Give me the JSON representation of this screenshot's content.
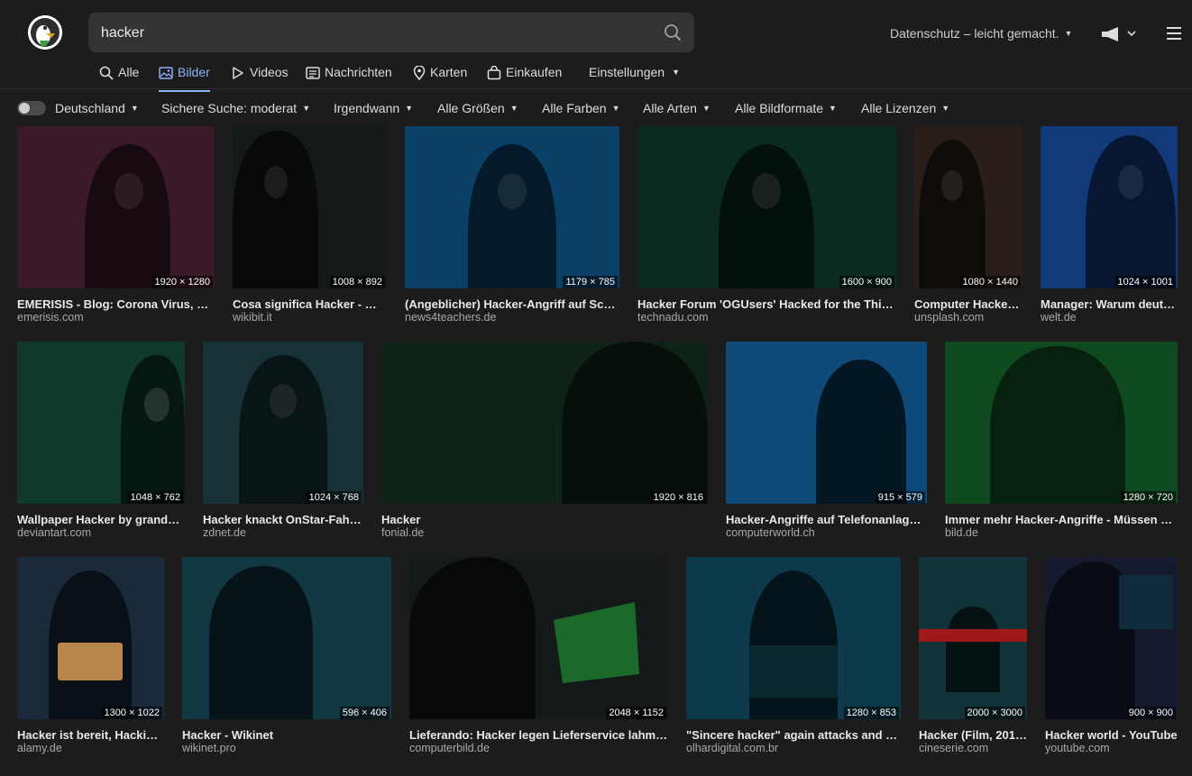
{
  "search": {
    "query": "hacker"
  },
  "header": {
    "privacy_label": "Datenschutz – leicht gemacht."
  },
  "tabs": [
    {
      "label": "Alle",
      "icon": "search-icon"
    },
    {
      "label": "Bilder",
      "icon": "image-icon",
      "active": true
    },
    {
      "label": "Videos",
      "icon": "play-icon"
    },
    {
      "label": "Nachrichten",
      "icon": "newspaper-icon"
    },
    {
      "label": "Karten",
      "icon": "map-pin-icon"
    },
    {
      "label": "Einkaufen",
      "icon": "shopping-bag-icon"
    },
    {
      "label": "Einstellungen",
      "icon": "chevron-down-icon"
    }
  ],
  "filters": [
    {
      "label": "Deutschland"
    },
    {
      "label": "Sichere Suche: moderat"
    },
    {
      "label": "Irgendwann"
    },
    {
      "label": "Alle Größen"
    },
    {
      "label": "Alle Farben"
    },
    {
      "label": "Alle Arten"
    },
    {
      "label": "Alle Bildformate"
    },
    {
      "label": "Alle Lizenzen"
    }
  ],
  "images": [
    {
      "title": "EMERISIS - Blog: Corona Virus, Hac...",
      "source": "emerisis.com",
      "dims": "1920 × 1280",
      "bg": "#3a1a28"
    },
    {
      "title": "Cosa significa Hacker - Wik...",
      "source": "wikibit.it",
      "dims": "1008 × 892",
      "bg": "#141a18"
    },
    {
      "title": "(Angeblicher) Hacker-Angriff auf Schul...",
      "source": "news4teachers.de",
      "dims": "1179 × 785",
      "bg": "#0a3f66"
    },
    {
      "title": "Hacker Forum 'OGUsers' Hacked for the Third ...",
      "source": "technadu.com",
      "dims": "1600 × 900",
      "bg": "#0b2a22"
    },
    {
      "title": "Computer Hacker ...",
      "source": "unsplash.com",
      "dims": "1080 × 1440",
      "bg": "#2a1f18"
    },
    {
      "title": "Manager: Warum deuts...",
      "source": "welt.de",
      "dims": "1024 × 1001",
      "bg": "#123a7a"
    },
    {
      "title": "Wallpaper Hacker by grandeti...",
      "source": "deviantart.com",
      "dims": "1048 × 762",
      "bg": "#0f3a2a"
    },
    {
      "title": "Hacker knackt OnStar-Fahrz...",
      "source": "zdnet.de",
      "dims": "1024 × 768",
      "bg": "#173237"
    },
    {
      "title": "Hacker",
      "source": "fonial.de",
      "dims": "1920 × 816",
      "bg": "#0e2218"
    },
    {
      "title": "Hacker-Angriffe auf Telefonanlagen ...",
      "source": "computerworld.ch",
      "dims": "915 × 579",
      "bg": "#0d4a7a"
    },
    {
      "title": "Immer mehr Hacker-Angriffe - Müssen wir ...",
      "source": "bild.de",
      "dims": "1280 × 720",
      "bg": "#0f4a1f"
    },
    {
      "title": "Hacker ist bereit, Hacking...",
      "source": "alamy.de",
      "dims": "1300 × 1022",
      "bg": "#1a2a3a"
    },
    {
      "title": "Hacker - Wikinet",
      "source": "wikinet.pro",
      "dims": "596 × 406",
      "bg": "#123844"
    },
    {
      "title": "Lieferando: Hacker legen Lieferservice lahm - ...",
      "source": "computerbild.de",
      "dims": "2048 × 1152",
      "bg": "#14191a"
    },
    {
      "title": "\"Sincere hacker\" again attacks and ridi...",
      "source": "olhardigital.com.br",
      "dims": "1280 × 853",
      "bg": "#0c3a4a"
    },
    {
      "title": "Hacker (Film, 2016...",
      "source": "cineserie.com",
      "dims": "2000 × 3000",
      "bg": "#12323a"
    },
    {
      "title": "Hacker world - YouTube",
      "source": "youtube.com",
      "dims": "900 × 900",
      "bg": "#161a30"
    }
  ]
}
